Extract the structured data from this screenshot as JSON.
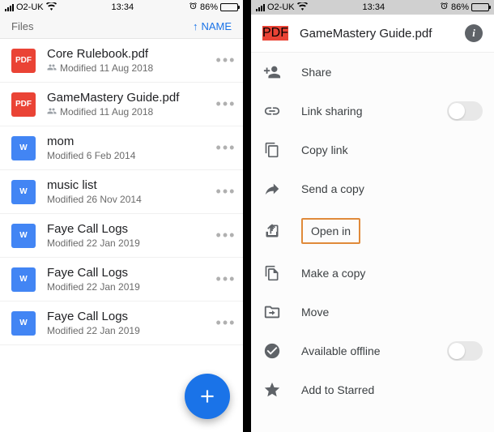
{
  "status": {
    "carrier": "O2-UK",
    "time": "13:34",
    "battery": "86%"
  },
  "left": {
    "header_label": "Files",
    "sort_label": "NAME",
    "files": [
      {
        "type": "pdf",
        "title": "Core Rulebook.pdf",
        "shared": true,
        "sub": "Modified 11 Aug 2018"
      },
      {
        "type": "pdf",
        "title": "GameMastery Guide.pdf",
        "shared": true,
        "sub": "Modified 11 Aug 2018"
      },
      {
        "type": "doc",
        "title": "mom",
        "shared": false,
        "sub": "Modified 6 Feb 2014"
      },
      {
        "type": "doc",
        "title": "music list",
        "shared": false,
        "sub": "Modified 26 Nov 2014"
      },
      {
        "type": "doc",
        "title": "Faye Call Logs",
        "shared": false,
        "sub": "Modified 22 Jan 2019"
      },
      {
        "type": "doc",
        "title": "Faye Call Logs",
        "shared": false,
        "sub": "Modified 22 Jan 2019"
      },
      {
        "type": "doc",
        "title": "Faye Call Logs",
        "shared": false,
        "sub": "Modified 22 Jan 2019"
      }
    ]
  },
  "right": {
    "file_title": "GameMastery Guide.pdf",
    "menu": {
      "share": "Share",
      "link_sharing": "Link sharing",
      "copy_link": "Copy link",
      "send_copy": "Send a copy",
      "open_in": "Open in",
      "make_copy": "Make a copy",
      "move": "Move",
      "available_offline": "Available offline",
      "add_starred": "Add to Starred"
    }
  }
}
